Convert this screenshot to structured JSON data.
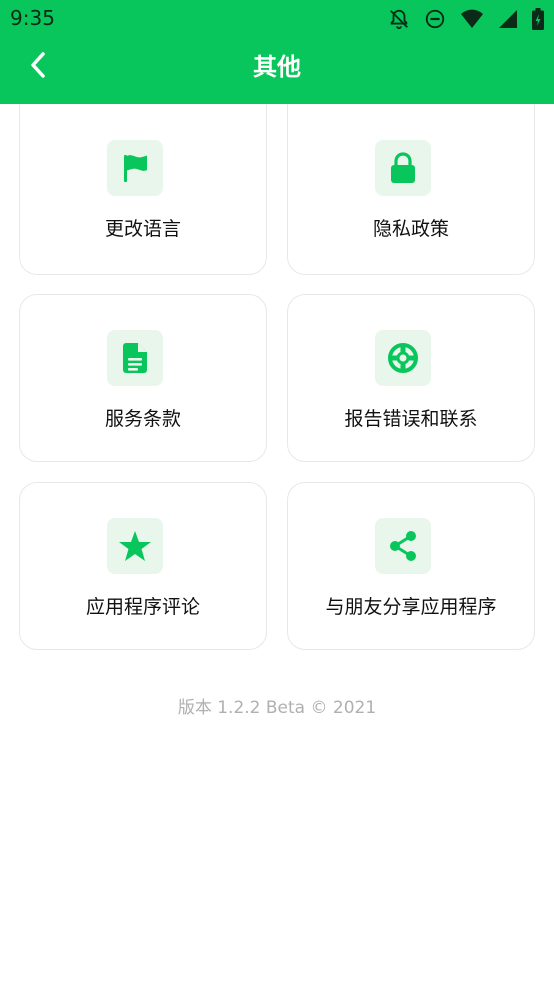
{
  "status": {
    "time": "9:35"
  },
  "header": {
    "title": "其他"
  },
  "cards": [
    {
      "label": "更改语言",
      "icon": "flag-icon"
    },
    {
      "label": "隐私政策",
      "icon": "lock-icon"
    },
    {
      "label": "服务条款",
      "icon": "document-icon"
    },
    {
      "label": "报告错误和联系",
      "icon": "lifebuoy-icon"
    },
    {
      "label": "应用程序评论",
      "icon": "star-icon"
    },
    {
      "label": "与朋友分享应用程序",
      "icon": "share-icon"
    }
  ],
  "footer": {
    "version": "版本 1.2.2 Beta © 2021"
  },
  "colors": {
    "accent": "#08c65b",
    "icon_background": "#e8f6ec",
    "version_text": "#b0b0b0"
  }
}
